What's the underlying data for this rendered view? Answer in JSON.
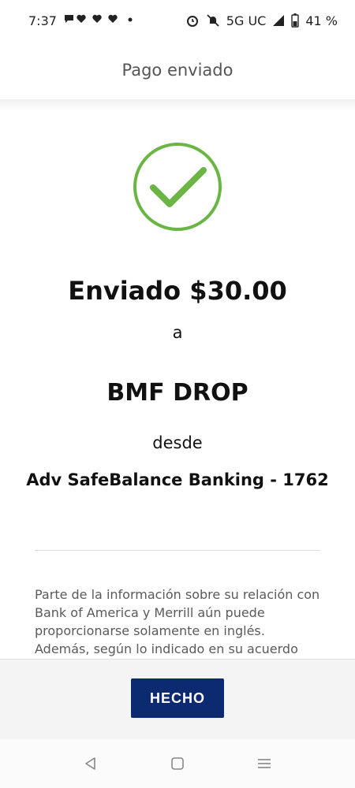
{
  "status_bar": {
    "time": "7:37",
    "network": "5G UC",
    "battery": "41 %",
    "icons": [
      "chat-bubble-icon",
      "heart-icon",
      "heart-icon",
      "heart-icon",
      "dot-icon",
      "alarm-icon",
      "mute-icon",
      "signal-icon",
      "battery-icon"
    ]
  },
  "header": {
    "title": "Pago enviado"
  },
  "confirmation": {
    "icon": "check-circle-icon",
    "accent_color": "#6bb544",
    "sent_text": "Enviado $30.00",
    "to_word": "a",
    "recipient": "BMF DROP",
    "from_word": "desde",
    "account": "Adv SafeBalance Banking - 1762"
  },
  "disclosure": {
    "text": "Parte de la información sobre su relación con Bank of America y Merrill aún puede proporcionarse solamente en inglés. Además, según lo indicado en su acuerdo"
  },
  "footer": {
    "done_label": "HECHO",
    "button_color": "#0b2a6f"
  },
  "nav_bar": {
    "icons": [
      "back-icon",
      "home-icon",
      "recents-icon"
    ]
  }
}
